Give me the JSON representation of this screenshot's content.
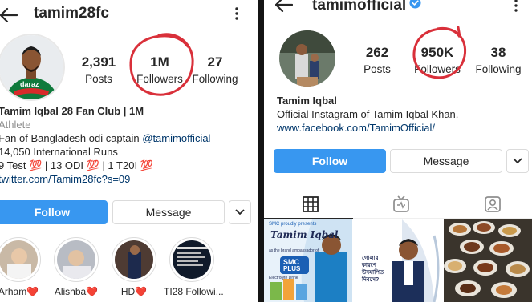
{
  "left": {
    "header": {
      "username": "tamim28fc"
    },
    "stats": [
      {
        "value": "2,391",
        "label": "Posts"
      },
      {
        "value": "1M",
        "label": "Followers"
      },
      {
        "value": "27",
        "label": "Following"
      }
    ],
    "bio": {
      "name": "Tamim Iqbal 28 Fan Club | 1M",
      "category": "Athlete",
      "line1_prefix": "Fan of Bangladesh odi captain ",
      "line1_mention": "@tamimofficial",
      "line2": "14,050 International Runs",
      "line3": "9 Test 💯 | 13 ODI 💯 | 1 T20I 💯",
      "link": "twitter.com/Tamim28fc?s=09"
    },
    "buttons": {
      "follow": "Follow",
      "message": "Message"
    },
    "highlights": [
      {
        "label": "Arham❤️"
      },
      {
        "label": "Alishba❤️"
      },
      {
        "label": "HD❤️"
      },
      {
        "label": "TI28 Followi..."
      }
    ],
    "avatar_text": "daraz"
  },
  "right": {
    "header": {
      "username": "tamimofficial"
    },
    "stats": [
      {
        "value": "262",
        "label": "Posts"
      },
      {
        "value": "950K",
        "label": "Followers"
      },
      {
        "value": "38",
        "label": "Following"
      }
    ],
    "bio": {
      "name": "Tamim Iqbal",
      "description": "Official Instagram of Tamim Iqbal Khan.",
      "link": "www.facebook.com/TamimOfficial/"
    },
    "buttons": {
      "follow": "Follow",
      "message": "Message"
    },
    "posts": {
      "ad1": {
        "top": "SMC proudly presents",
        "signature": "Tamim Iqbal",
        "tagline": "as the brand ambassador of",
        "brand": "SMC",
        "product": "PLUS",
        "sub": "Electrolyte Drink"
      },
      "ad2": {
        "bangla": "গোলার কারণে উদযাপিত দিবসে?"
      }
    },
    "colors": {
      "accent": "#3897f0",
      "verified": "#3897f0",
      "annotation": "#d9303a"
    }
  }
}
